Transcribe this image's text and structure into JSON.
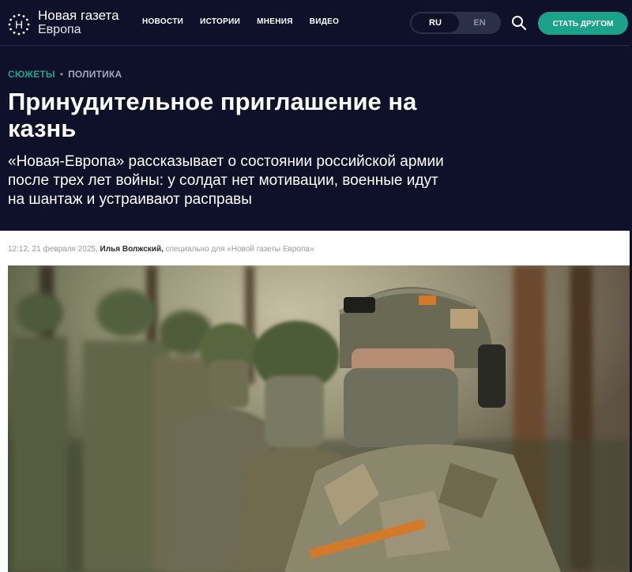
{
  "brand": {
    "name_line1": "Новая газета",
    "name_line2": "Европа",
    "logo_letter": "Н"
  },
  "nav": {
    "items": [
      "НОВОСТИ",
      "ИСТОРИИ",
      "МНЕНИЯ",
      "ВИДЕО"
    ]
  },
  "language": {
    "options": [
      "RU",
      "EN"
    ],
    "selected": "RU"
  },
  "header_actions": {
    "search_icon": "search-icon",
    "friend_button": "СТАТЬ ДРУГОМ"
  },
  "breadcrumbs": {
    "items": [
      "СЮЖЕТЫ",
      "ПОЛИТИКА"
    ],
    "separator": "•"
  },
  "article": {
    "title": "Принудительное приглашение на казнь",
    "lead": "«Новая-Европа» рассказывает о состоянии российской армии после трех лет войны: у солдат нет мотивации, военные идут на шантаж и устраивают расправы",
    "timestamp": "12:12, 21 февраля 2025,",
    "author": "Илья Волжский,",
    "credit": "специально для «Новой газеты Европа»"
  },
  "colors": {
    "header_bg": "#0e1129",
    "accent": "#1aa38a",
    "text_on_dark": "#ffffff"
  }
}
